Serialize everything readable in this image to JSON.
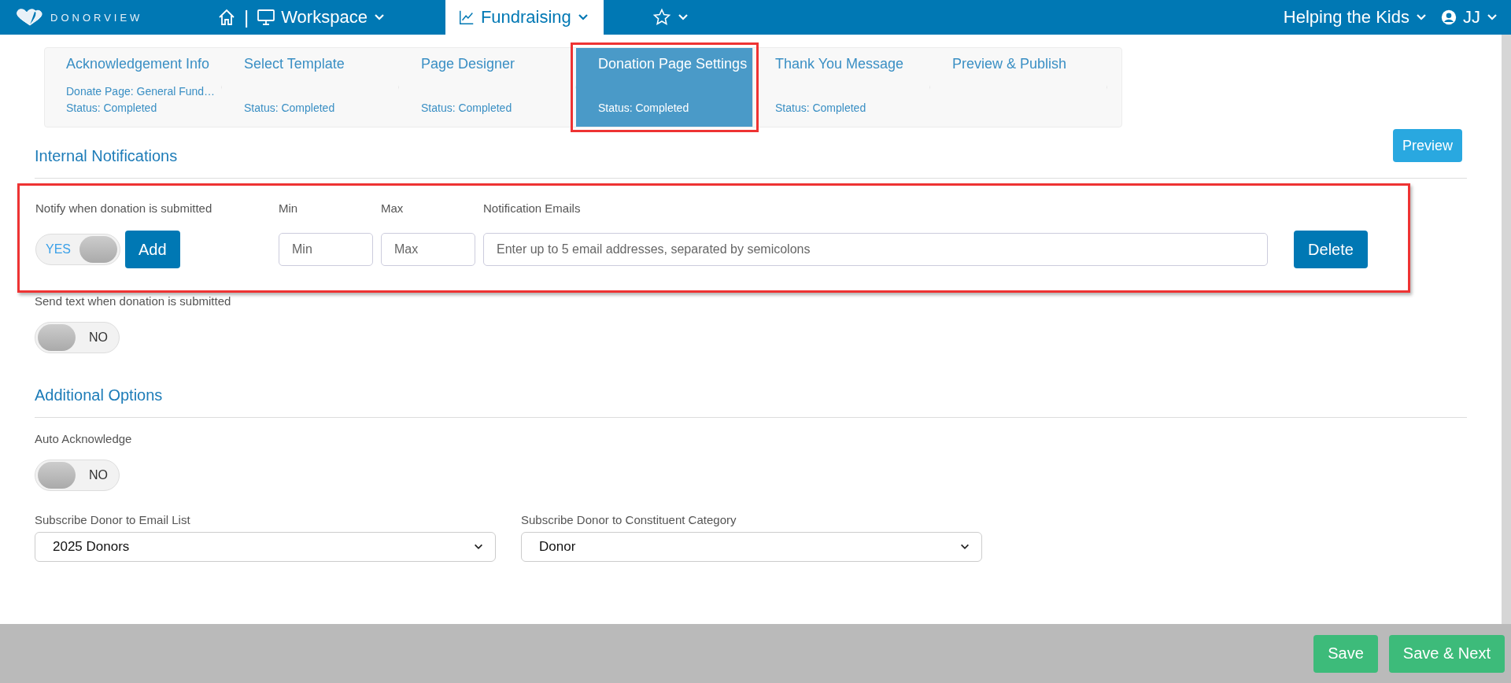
{
  "topbar": {
    "logo": "DONORVIEW",
    "separator": "|",
    "menus": [
      {
        "kind": "workspace",
        "label": "Workspace",
        "selected": false
      },
      {
        "kind": "fundraising",
        "label": "Fundraising",
        "selected": true
      },
      {
        "kind": "favorites",
        "selected": false
      }
    ],
    "org": "Helping the Kids",
    "user": "JJ"
  },
  "steps": [
    {
      "title": "Acknowledgement Info",
      "subtitle": "Donate Page: General Fund…",
      "status": "Status: Completed",
      "selected": false
    },
    {
      "title": "Select Template",
      "status": "Status: Completed",
      "selected": false
    },
    {
      "title": "Page Designer",
      "status": "Status: Completed",
      "selected": false
    },
    {
      "title": "Donation Page Settings",
      "status": "Status: Completed",
      "selected": true
    },
    {
      "title": "Thank You Message",
      "status": "Status: Completed",
      "selected": false
    },
    {
      "title": "Preview & Publish",
      "selected": false
    }
  ],
  "preview_button": "Preview",
  "internal_notifications": {
    "title": "Internal Notifications",
    "notify": {
      "label": "Notify when donation is submitted",
      "toggle": {
        "on": true,
        "label": "YES"
      },
      "add_button": "Add",
      "min": {
        "label": "Min",
        "placeholder": "Min"
      },
      "max": {
        "label": "Max",
        "placeholder": "Max"
      },
      "emails": {
        "label": "Notification Emails",
        "placeholder": "Enter up to 5 email addresses, separated by semicolons"
      },
      "delete_button": "Delete"
    },
    "send_text": {
      "label": "Send text when donation is submitted",
      "toggle": {
        "on": false,
        "label": "NO"
      }
    }
  },
  "additional_options": {
    "title": "Additional Options",
    "auto_acknowledge": {
      "label": "Auto Acknowledge",
      "toggle": {
        "on": false,
        "label": "NO"
      }
    },
    "selects": [
      {
        "label": "Subscribe Donor to Email List",
        "value": "2025 Donors"
      },
      {
        "label": "Subscribe Donor to Constituent Category",
        "value": "Donor"
      }
    ]
  },
  "footer": {
    "buttons": [
      "Save",
      "Save & Next"
    ]
  }
}
